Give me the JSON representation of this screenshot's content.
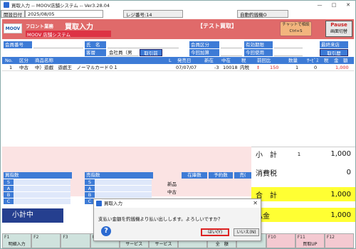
{
  "window": {
    "title": "買取入力 -- MOOV店舗システム -- Ver3.28.04",
    "minimize": "—",
    "maximize": "□",
    "close": "✕"
  },
  "infobar": {
    "open_label": "開設日付",
    "date": "2025/08/05",
    "register_label": "レジ番号:14",
    "auto_print": "自動釣銭機O"
  },
  "header": {
    "logo": "MOOV",
    "badge": "フロント業務",
    "title": "買取入力",
    "subtitle": "MOOV 店舗システム",
    "mode": "【テスト買取】",
    "chat_line1": "チャットで相談",
    "chat_line2": "Ctrl+S",
    "pause_line1": "Pause",
    "pause_line2": "画面切替"
  },
  "form": {
    "member_no_label": "会員番号",
    "member_no": "",
    "name_label": "氏　名",
    "name": "",
    "customer_label": "客層",
    "customer": "会社員（男",
    "trade_before": "取引前",
    "member_type_label": "会員区分",
    "member_type": "",
    "expiry_label": "有効期限",
    "expiry": "",
    "last_visit_label": "最終来店",
    "last_visit": "",
    "points_add_label": "今回加算",
    "points_add": "",
    "points_use_label": "今回使用",
    "points_use": "",
    "trade_history": "取引歴"
  },
  "grid": {
    "columns": [
      "No.",
      "区分",
      "商品名称",
      "L",
      "発売日",
      "新在",
      "中在",
      "税",
      "前回比",
      "数量",
      "ｻｰﾋﾞｽ",
      "税",
      "金　額"
    ],
    "rows": [
      {
        "no": "1",
        "kubun": "中古",
        "name": "中）遊戯　遊戯王　ノーマルカード０１",
        "release": "07/07/07",
        "new_stock": "-3",
        "used_stock": "10018",
        "tax": "内税",
        "flag": "!",
        "prev": "150",
        "qty": "1",
        "service": "0",
        "amount": "1,000"
      }
    ]
  },
  "totals": {
    "subtotal_label": "小　計",
    "subtotal_qty": "1",
    "subtotal": "1,000",
    "tax_label": "消費税",
    "tax": "0",
    "total_label": "合　計",
    "total": "1,000",
    "pay_label": "払金",
    "pay": "1,000"
  },
  "buy_count": {
    "title": "買指数",
    "rows": [
      "S",
      "A",
      "B",
      "C"
    ]
  },
  "sell_count": {
    "title": "売指数",
    "rows": [
      "S",
      "A",
      "B",
      "C"
    ]
  },
  "stock": {
    "h1": "在庫数",
    "h2": "予約数",
    "h3": "売(",
    "new": "新品",
    "used": "中古"
  },
  "subtotal_button": "小計中",
  "fkeys": [
    {
      "key": "F1",
      "label": "明細入力"
    },
    {
      "key": "F2",
      "label": ""
    },
    {
      "key": "F3",
      "label": ""
    },
    {
      "key": "F4",
      "label": ""
    },
    {
      "key": "F5",
      "label": "サービス"
    },
    {
      "key": "F6",
      "label": "サービス"
    },
    {
      "key": "F7",
      "label": ""
    },
    {
      "key": "F8",
      "label": "全　額"
    },
    {
      "key": "F9",
      "label": ""
    },
    {
      "key": "F10",
      "label": ""
    },
    {
      "key": "F11",
      "label": "買取UP"
    },
    {
      "key": "F12",
      "label": ""
    }
  ],
  "dialog": {
    "title": "買取入力",
    "close": "✕",
    "message": "支払い金額を釣銭機より払い出しします。よろしいですか？",
    "icon": "?",
    "yes": "はい(Y)",
    "no": "いいえ(N)"
  },
  "colors": {
    "header": "#e06a6a",
    "accent_blue": "#3d7bd6",
    "total_yellow": "#ffff33",
    "alert_red": "#d22"
  }
}
